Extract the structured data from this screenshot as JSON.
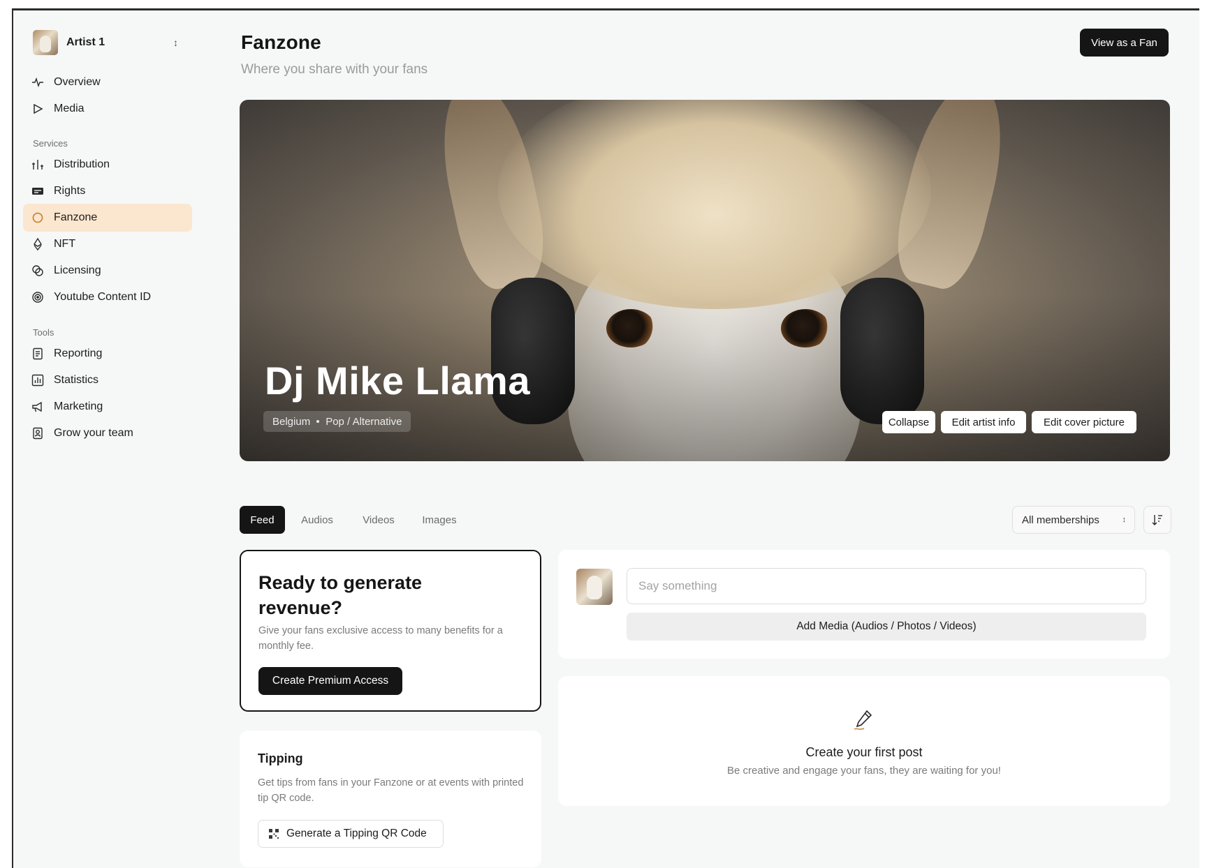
{
  "account": {
    "name": "Artist 1",
    "switch_icon": "chevron-up-down-icon"
  },
  "sidebar": {
    "primary": [
      {
        "label": "Overview",
        "icon": "activity-icon"
      },
      {
        "label": "Media",
        "icon": "play-icon"
      }
    ],
    "services_heading": "Services",
    "services": [
      {
        "label": "Distribution",
        "icon": "distribution-icon"
      },
      {
        "label": "Rights",
        "icon": "rights-icon"
      },
      {
        "label": "Fanzone",
        "icon": "circle-icon",
        "active": true
      },
      {
        "label": "NFT",
        "icon": "ethereum-icon"
      },
      {
        "label": "Licensing",
        "icon": "licensing-icon"
      },
      {
        "label": "Youtube Content ID",
        "icon": "content-id-icon"
      }
    ],
    "tools_heading": "Tools",
    "tools": [
      {
        "label": "Reporting",
        "icon": "report-icon"
      },
      {
        "label": "Statistics",
        "icon": "chart-icon"
      },
      {
        "label": "Marketing",
        "icon": "megaphone-icon"
      },
      {
        "label": "Grow your team",
        "icon": "contact-icon"
      }
    ],
    "active_color": "#fbe6cf"
  },
  "header": {
    "title": "Fanzone",
    "subtitle": "Where you share with your fans",
    "view_as_fan": "View as a Fan"
  },
  "cover": {
    "artist_name": "Dj Mike Llama",
    "country": "Belgium",
    "genre": "Pop / Alternative",
    "collapse": "Collapse",
    "edit_info": "Edit artist info",
    "edit_cover": "Edit cover picture"
  },
  "tabs": [
    {
      "label": "Feed",
      "active": true
    },
    {
      "label": "Audios"
    },
    {
      "label": "Videos"
    },
    {
      "label": "Images"
    }
  ],
  "filter": {
    "selected": "All memberships",
    "sort_icon": "sort-icon"
  },
  "revenue": {
    "title": "Ready to generate revenue?",
    "text": "Give your fans exclusive access to many benefits for a monthly fee.",
    "button": "Create Premium Access"
  },
  "tipping": {
    "title": "Tipping",
    "text": "Get tips from fans in your Fanzone or at events with printed tip QR code.",
    "button": "Generate a Tipping QR Code",
    "button_icon": "qr-code-icon"
  },
  "composer": {
    "placeholder": "Say something",
    "add_media": "Add Media (Audios / Photos / Videos)"
  },
  "empty_state": {
    "icon": "pen-icon",
    "title": "Create your first post",
    "text": "Be creative and engage your fans, they are waiting for you!",
    "accent": "#c68a3c"
  }
}
